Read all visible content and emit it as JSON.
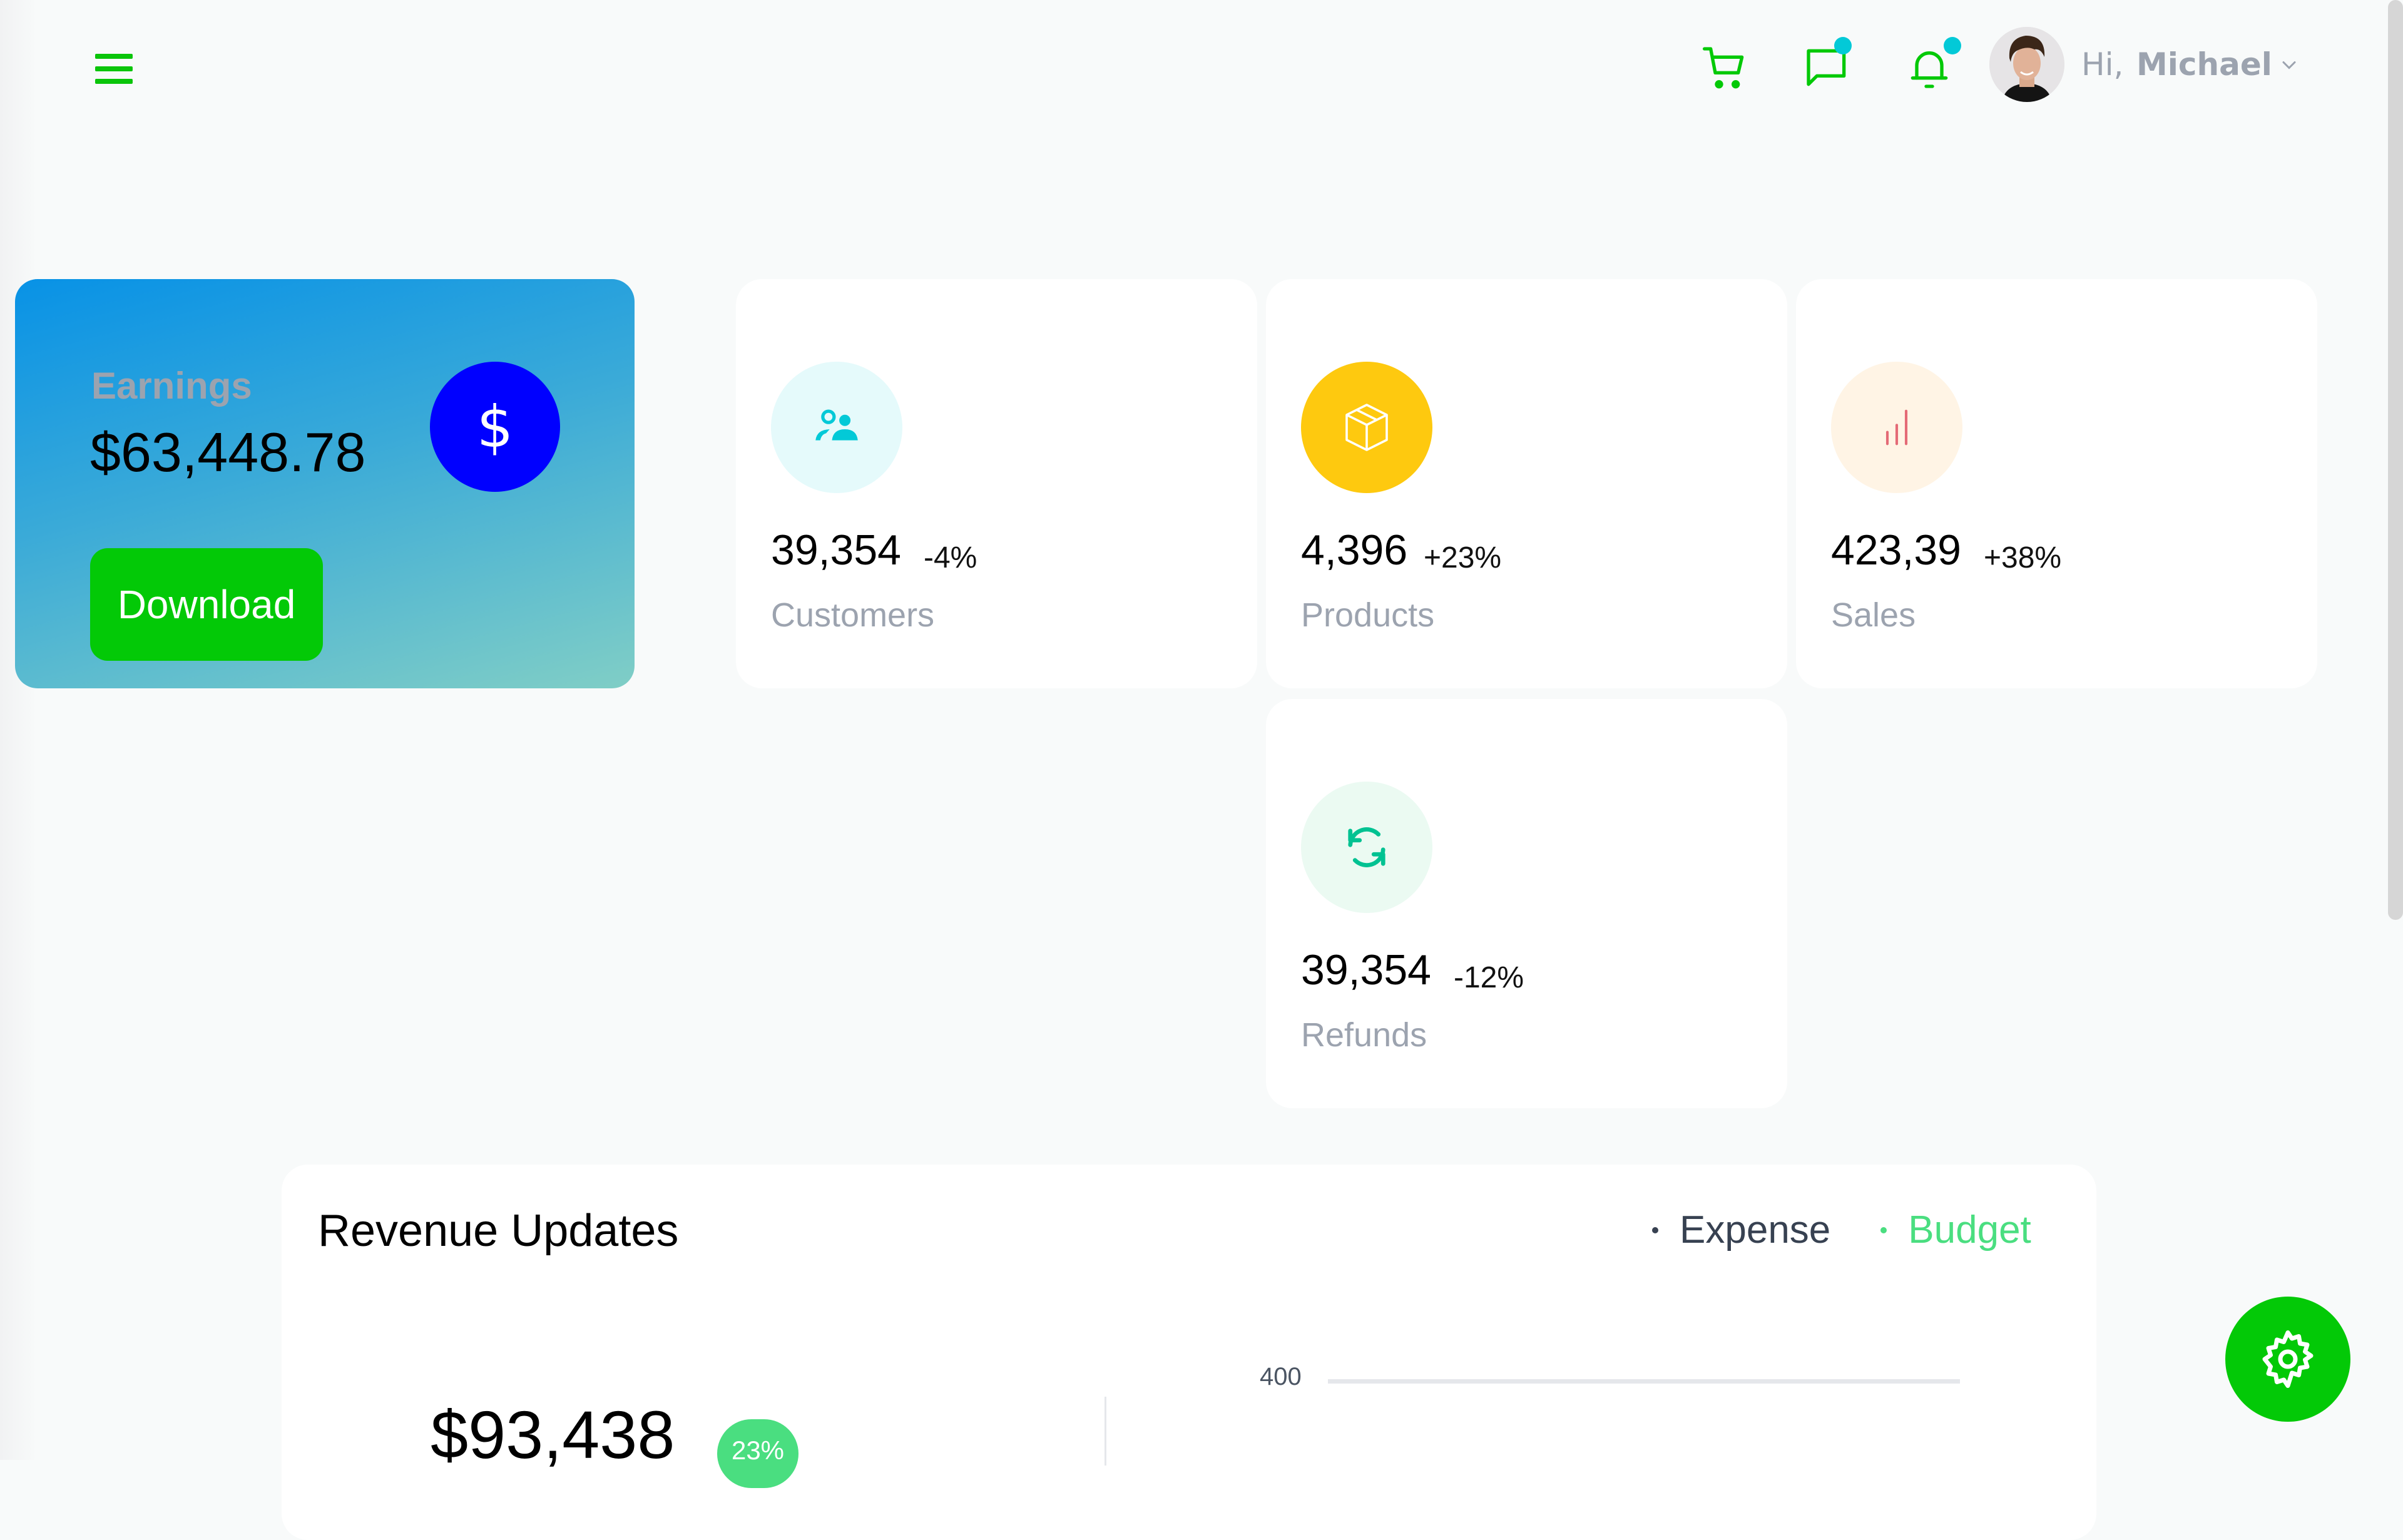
{
  "header": {
    "menu_icon": "hamburger-menu-icon",
    "icons": [
      {
        "name": "cart-icon",
        "badge": false
      },
      {
        "name": "chat-icon",
        "badge": true
      },
      {
        "name": "notification-bell-icon",
        "badge": true
      }
    ],
    "user": {
      "greeting": "Hi,",
      "name": "Michael",
      "avatar": "user-avatar-photo",
      "dropdown_icon": "chevron-down-icon"
    },
    "badge_color": "#03c9d7",
    "accent_color": "#03c907"
  },
  "earnings": {
    "label": "Earnings",
    "value": "$63,448.78",
    "icon": "dollar-icon",
    "icon_bg_color": "#0000ff",
    "download_label": "Download",
    "button_color": "#03c907"
  },
  "stats": [
    {
      "label": "Customers",
      "value": "39,354",
      "change": "-4%",
      "icon": "users-icon",
      "icon_color": "#03c9d7",
      "icon_bg": "#e5fafb"
    },
    {
      "label": "Products",
      "value": "4,396",
      "change": "+23%",
      "icon": "box-icon",
      "icon_color": "#ffffff",
      "icon_bg": "#fec90f"
    },
    {
      "label": "Sales",
      "value": "423,39",
      "change": "+38%",
      "icon": "bar-chart-icon",
      "icon_color": "#e46a76",
      "icon_bg": "#fff4e5"
    },
    {
      "label": "Refunds",
      "value": "39,354",
      "change": "-12%",
      "icon": "refresh-icon",
      "icon_color": "#00c292",
      "icon_bg": "#ebfaf2"
    }
  ],
  "revenue": {
    "title": "Revenue Updates",
    "legend": [
      {
        "label": "Expense",
        "color": "#374151"
      },
      {
        "label": "Budget",
        "color": "#4ade80"
      }
    ],
    "amount": "$93,438",
    "badge": "23%",
    "y_ticks": [
      "400"
    ]
  },
  "settings_fab": {
    "icon": "gear-icon"
  }
}
